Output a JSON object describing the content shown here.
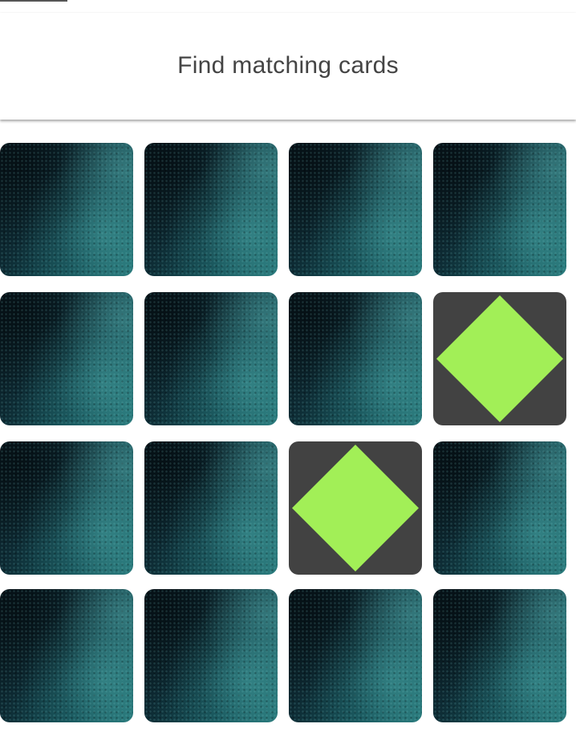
{
  "header": {
    "title": "Find matching cards"
  },
  "board": {
    "rows": 4,
    "columns": 4,
    "card_back": "teal-textured-card-back",
    "face_background_color": "#424242",
    "cards": [
      {
        "state": "face-down"
      },
      {
        "state": "face-down"
      },
      {
        "state": "face-down"
      },
      {
        "state": "face-down"
      },
      {
        "state": "face-down"
      },
      {
        "state": "face-down"
      },
      {
        "state": "face-down"
      },
      {
        "state": "face-up",
        "symbol": "diamond-icon",
        "color": "#a2ef57"
      },
      {
        "state": "face-down"
      },
      {
        "state": "face-down"
      },
      {
        "state": "face-up",
        "symbol": "diamond-icon",
        "color": "#a2ef57"
      },
      {
        "state": "face-down"
      },
      {
        "state": "face-down"
      },
      {
        "state": "face-down"
      },
      {
        "state": "face-down"
      },
      {
        "state": "face-down"
      }
    ]
  }
}
